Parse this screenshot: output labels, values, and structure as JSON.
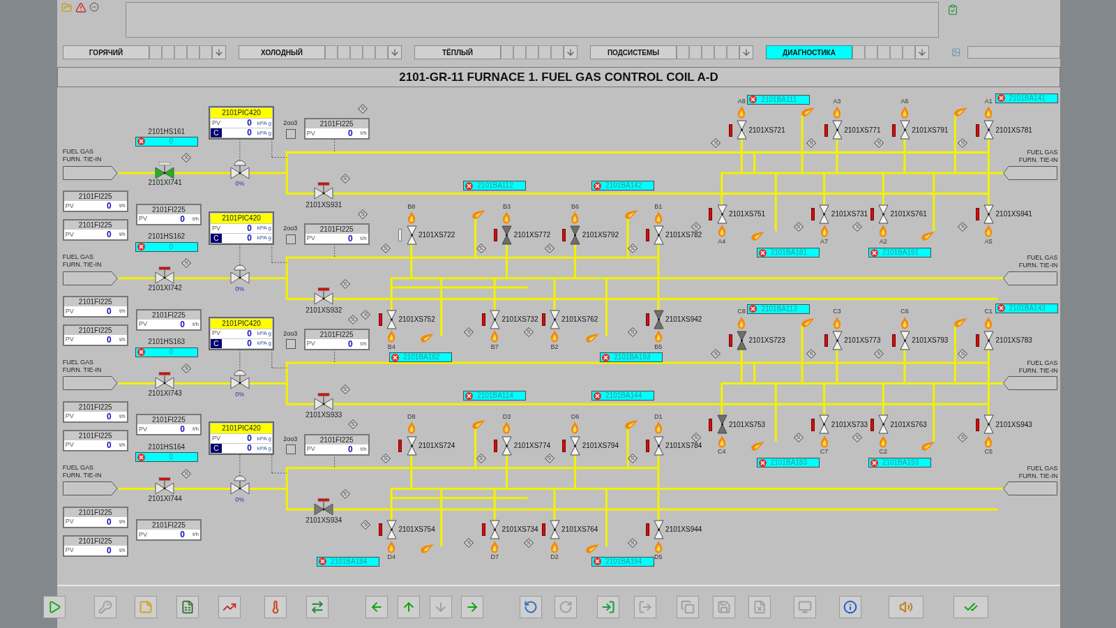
{
  "tabs": [
    {
      "label": "ГОРЯЧИЙ",
      "selected": false
    },
    {
      "label": "ХОЛОДНЫЙ",
      "selected": false
    },
    {
      "label": "ТЁПЛЫЙ",
      "selected": false
    },
    {
      "label": "ПОДСИСТЕМЫ",
      "selected": false
    },
    {
      "label": "ДИАГНОСТИКА",
      "selected": true
    }
  ],
  "title": "2101-GR-11 FURNACE 1. FUEL GAS CONTROL COIL A-D",
  "sections": [
    {
      "inlet_label": [
        "FUEL GAS",
        "FURN. TIE-IN"
      ],
      "outlet_label": [
        "FUEL GAS",
        "FURN. TIE-IN"
      ],
      "hs": {
        "tag": "2101HS161",
        "value": "0"
      },
      "pic": {
        "tag": "2101PIC420",
        "pv_label": "PV",
        "pv": "0",
        "pv_unit": "kPA g",
        "c_label": "C",
        "c_value": "0",
        "c_unit": "kPA g"
      },
      "vote": {
        "label": "2oo3",
        "checked": false
      },
      "fi_right": {
        "tag": "2101FI225",
        "pv_label": "PV",
        "value": "0",
        "unit": "t/h"
      },
      "fi_mid": {
        "tag": "2101FI225",
        "pv_label": "PV",
        "value": "0",
        "unit": "t/h"
      },
      "fi_left": [
        {
          "tag": "2101FI225",
          "pv_label": "PV",
          "value": "0",
          "unit": "t/h"
        },
        {
          "tag": "2101FI225",
          "pv_label": "PV",
          "value": "0",
          "unit": "t/h"
        }
      ],
      "xi_valve": {
        "tag": "2101XI741",
        "open": true
      },
      "cv_reading": "0%",
      "xs_valve": {
        "tag": "2101XS931",
        "closed": false
      },
      "marks": [
        "S",
        "S",
        "S"
      ],
      "burners_upper": [
        {
          "tag": "2101XS721",
          "flame_label": "A8",
          "closed": false,
          "tripped": true,
          "mark": "S"
        },
        {
          "tag": "2101XS771",
          "flame_label": "A3",
          "closed": false,
          "tripped": true,
          "mark": "S"
        },
        {
          "tag": "2101XS791",
          "flame_label": "A6",
          "closed": false,
          "tripped": true,
          "mark": "S"
        },
        {
          "tag": "2101XS781",
          "flame_label": "A1",
          "closed": false,
          "tripped": true,
          "mark": "S"
        }
      ],
      "burners_lower": [
        {
          "tag": "2101XS751",
          "flame_label": "A4",
          "closed": false,
          "tripped": true,
          "mark": "S"
        },
        {
          "tag": "2101XS731",
          "flame_label": "A7",
          "closed": false,
          "tripped": true,
          "mark": "S"
        },
        {
          "tag": "2101XS761",
          "flame_label": "A2",
          "closed": false,
          "tripped": true,
          "mark": "S"
        },
        {
          "tag": "2101XS941",
          "flame_label": "A5",
          "closed": false,
          "tripped": true,
          "mark": "S"
        }
      ]
    },
    {
      "inlet_label": [
        "FUEL GAS",
        "FURN. TIE-IN"
      ],
      "outlet_label": [
        "FUEL GAS",
        "FURN. TIE-IN"
      ],
      "hs": {
        "tag": "2101HS162",
        "value": "0"
      },
      "pic": {
        "tag": "2101PIC420",
        "pv_label": "PV",
        "pv": "0",
        "pv_unit": "kPA g",
        "c_label": "C",
        "c_value": "0",
        "c_unit": "kPA g"
      },
      "vote": {
        "label": "2oo3",
        "checked": false
      },
      "fi_right": {
        "tag": "2101FI225",
        "pv_label": "PV",
        "value": "0",
        "unit": "t/h"
      },
      "fi_mid": {
        "tag": "2101FI225",
        "pv_label": "PV",
        "value": "0",
        "unit": "t/h"
      },
      "fi_left": [
        {
          "tag": "2101FI225",
          "pv_label": "PV",
          "value": "0",
          "unit": "t/h"
        },
        {
          "tag": "2101FI225",
          "pv_label": "PV",
          "value": "0",
          "unit": "t/h"
        }
      ],
      "xi_valve": {
        "tag": "2101XI742",
        "open": false
      },
      "cv_reading": "0%",
      "xs_valve": {
        "tag": "2101XS932",
        "closed": false
      },
      "marks": [
        "S",
        "S",
        "S"
      ],
      "burners_upper": [
        {
          "tag": "2101XS722",
          "flame_label": "B8",
          "closed": false,
          "tripped": false,
          "mark": "S"
        },
        {
          "tag": "2101XS772",
          "flame_label": "B3",
          "closed": true,
          "tripped": true,
          "mark": "S"
        },
        {
          "tag": "2101XS792",
          "flame_label": "B6",
          "closed": true,
          "tripped": true,
          "mark": "S"
        },
        {
          "tag": "2101XS782",
          "flame_label": "B1",
          "closed": false,
          "tripped": true,
          "mark": "S"
        }
      ],
      "burners_lower": [
        {
          "tag": "2101XS752",
          "flame_label": "B4",
          "closed": false,
          "tripped": true,
          "mark": "S"
        },
        {
          "tag": "2101XS732",
          "flame_label": "B7",
          "closed": false,
          "tripped": true,
          "mark": "S"
        },
        {
          "tag": "2101XS762",
          "flame_label": "B2",
          "closed": false,
          "tripped": true,
          "mark": "S"
        },
        {
          "tag": "2101XS942",
          "flame_label": "B5",
          "closed": true,
          "tripped": true,
          "mark": "S"
        }
      ]
    },
    {
      "inlet_label": [
        "FUEL GAS",
        "FURN. TIE-IN"
      ],
      "outlet_label": [
        "FUEL GAS",
        "FURN. TIE-IN"
      ],
      "hs": {
        "tag": "2101HS163",
        "value": "0"
      },
      "pic": {
        "tag": "2101PIC420",
        "pv_label": "PV",
        "pv": "0",
        "pv_unit": "kPA g",
        "c_label": "C",
        "c_value": "0",
        "c_unit": "kPA g"
      },
      "vote": {
        "label": "2oo3",
        "checked": false
      },
      "fi_right": {
        "tag": "2101FI225",
        "pv_label": "PV",
        "value": "0",
        "unit": "t/h"
      },
      "fi_mid": {
        "tag": "2101FI225",
        "pv_label": "PV",
        "value": "0",
        "unit": "t/h"
      },
      "fi_left": [
        {
          "tag": "2101FI225",
          "pv_label": "PV",
          "value": "0",
          "unit": "t/h"
        },
        {
          "tag": "2101FI225",
          "pv_label": "PV",
          "value": "0",
          "unit": "t/h"
        }
      ],
      "xi_valve": {
        "tag": "2101XI743",
        "open": false
      },
      "cv_reading": "0%",
      "xs_valve": {
        "tag": "2101XS933",
        "closed": false
      },
      "marks": [
        "S",
        "S",
        "S"
      ],
      "burners_upper": [
        {
          "tag": "2101XS723",
          "flame_label": "C8",
          "closed": true,
          "tripped": true,
          "mark": "S"
        },
        {
          "tag": "2101XS773",
          "flame_label": "C3",
          "closed": false,
          "tripped": true,
          "mark": "S"
        },
        {
          "tag": "2101XS793",
          "flame_label": "C6",
          "closed": false,
          "tripped": true,
          "mark": "S"
        },
        {
          "tag": "2101XS783",
          "flame_label": "C1",
          "closed": false,
          "tripped": true,
          "mark": "S"
        }
      ],
      "burners_lower": [
        {
          "tag": "2101XS753",
          "flame_label": "C4",
          "closed": true,
          "tripped": true,
          "mark": "S"
        },
        {
          "tag": "2101XS733",
          "flame_label": "C7",
          "closed": false,
          "tripped": true,
          "mark": "S"
        },
        {
          "tag": "2101XS763",
          "flame_label": "C2",
          "closed": false,
          "tripped": true,
          "mark": "S"
        },
        {
          "tag": "2101XS943",
          "flame_label": "C5",
          "closed": false,
          "tripped": true,
          "mark": "S"
        }
      ]
    },
    {
      "inlet_label": [
        "FUEL GAS",
        "FURN. TIE-IN"
      ],
      "outlet_label": [
        "FUEL GAS",
        "FURN. TIE-IN"
      ],
      "hs": {
        "tag": "2101HS164",
        "value": "0"
      },
      "pic": {
        "tag": "2101PIC420",
        "pv_label": "PV",
        "pv": "0",
        "pv_unit": "kPA g",
        "c_label": "C",
        "c_value": "0",
        "c_unit": "kPA g"
      },
      "vote": {
        "label": "2oo3",
        "checked": false
      },
      "fi_right": {
        "tag": "2101FI225",
        "pv_label": "PV",
        "value": "0",
        "unit": "t/h"
      },
      "fi_mid": {
        "tag": "2101FI225",
        "pv_label": "PV",
        "value": "0",
        "unit": "t/h"
      },
      "fi_left": [
        {
          "tag": "2101FI225",
          "pv_label": "PV",
          "value": "0",
          "unit": "t/h"
        },
        {
          "tag": "2101FI225",
          "pv_label": "PV",
          "value": "0",
          "unit": "t/h"
        }
      ],
      "xi_valve": {
        "tag": "2101XI744",
        "open": false
      },
      "cv_reading": "0%",
      "xs_valve": {
        "tag": "2101XS934",
        "closed": true
      },
      "marks": [
        "S",
        "S",
        "S"
      ],
      "burners_upper": [
        {
          "tag": "2101XS724",
          "flame_label": "D8",
          "closed": false,
          "tripped": true,
          "mark": "S"
        },
        {
          "tag": "2101XS774",
          "flame_label": "D3",
          "closed": false,
          "tripped": true,
          "mark": "S"
        },
        {
          "tag": "2101XS794",
          "flame_label": "D6",
          "closed": false,
          "tripped": true,
          "mark": "S"
        },
        {
          "tag": "2101XS784",
          "flame_label": "D1",
          "closed": false,
          "tripped": true,
          "mark": "S"
        }
      ],
      "burners_lower": [
        {
          "tag": "2101XS754",
          "flame_label": "D4",
          "closed": false,
          "tripped": true,
          "mark": "S"
        },
        {
          "tag": "2101XS734",
          "flame_label": "D7",
          "closed": false,
          "tripped": true,
          "mark": "S"
        },
        {
          "tag": "2101XS764",
          "flame_label": "D2",
          "closed": false,
          "tripped": true,
          "mark": "S"
        },
        {
          "tag": "2101XS944",
          "flame_label": "D5",
          "closed": false,
          "tripped": true,
          "mark": "S"
        }
      ]
    }
  ],
  "alarms": [
    "2101BA111",
    "2101BA141",
    "2101BA112",
    "2101BA142",
    "2101BA181",
    "2101BA191",
    "2101BA182",
    "2101BA193",
    "2101BA113",
    "2101BA143",
    "2101BA114",
    "2101BA144",
    "2101BA183",
    "2101BA193",
    "2101BA184",
    "2101BA194"
  ],
  "toolbar": [
    {
      "kind": "play",
      "disabled": false
    },
    {
      "kind": "key",
      "disabled": true
    },
    {
      "kind": "note",
      "disabled": false
    },
    {
      "kind": "report",
      "disabled": false
    },
    {
      "kind": "trend",
      "disabled": false
    },
    {
      "kind": "thermometer",
      "disabled": false
    },
    {
      "kind": "transfer",
      "disabled": false
    },
    {
      "kind": "left",
      "disabled": false
    },
    {
      "kind": "up",
      "disabled": false
    },
    {
      "kind": "down",
      "disabled": true
    },
    {
      "kind": "right",
      "disabled": false
    },
    {
      "kind": "undo",
      "disabled": false
    },
    {
      "kind": "redo",
      "disabled": true
    },
    {
      "kind": "import",
      "disabled": false
    },
    {
      "kind": "export",
      "disabled": true
    },
    {
      "kind": "copy",
      "disabled": true
    },
    {
      "kind": "save",
      "disabled": true
    },
    {
      "kind": "delete",
      "disabled": true
    },
    {
      "kind": "monitor",
      "disabled": true
    },
    {
      "kind": "info",
      "disabled": false
    },
    {
      "kind": "sound",
      "disabled": false
    },
    {
      "kind": "acknowledge",
      "disabled": false
    }
  ]
}
